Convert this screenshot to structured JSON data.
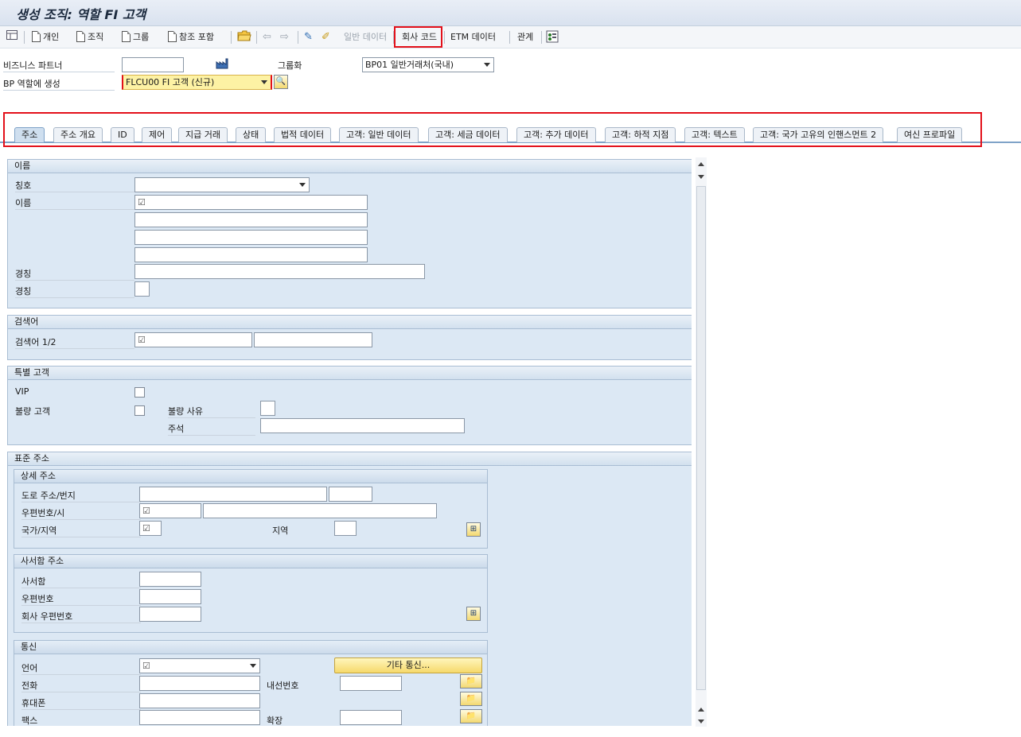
{
  "window": {
    "title": "생성 조직: 역할 FI 고객"
  },
  "toolbar": {
    "person": "개인",
    "org": "조직",
    "group": "그룹",
    "ref": "참조 포함",
    "general_data": "일반 데이터",
    "company_code": "회사 코드",
    "etm_data": "ETM 데이터",
    "relations": "관계"
  },
  "header": {
    "bp_label": "비즈니스 파트너",
    "grouping_label": "그룹화",
    "grouping_value": "BP01 일반거래처(국내)",
    "role_label": "BP 역할에 생성",
    "role_value": "FLCU00 FI 고객 (신규)"
  },
  "tabs": [
    "주소",
    "주소 개요",
    "ID",
    "제어",
    "지급 거래",
    "상태",
    "법적 데이터",
    "고객: 일반 데이터",
    "고객: 세금 데이터",
    "고객: 추가 데이터",
    "고객: 하적 지점",
    "고객: 텍스트",
    "고객: 국가 고유의 인핸스먼트 2",
    "여신 프로파일"
  ],
  "name": {
    "title": "이름",
    "salutation": "칭호",
    "name": "이름",
    "title1": "경칭",
    "title2": "경칭",
    "req": "☑"
  },
  "search": {
    "title": "검색어",
    "label": "검색어 1/2",
    "req": "☑"
  },
  "special": {
    "title": "특별 고객",
    "vip": "VIP",
    "bad": "불량 고객",
    "bad_reason": "불량 사유",
    "comment": "주석"
  },
  "std_address": {
    "title": "표준 주소",
    "detail": {
      "title": "상세 주소",
      "street": "도로 주소/번지",
      "postal_city": "우편번호/시",
      "country": "국가/지역",
      "region": "지역",
      "req": "☑"
    },
    "pobox": {
      "title": "사서함 주소",
      "pobox": "사서함",
      "postal": "우편번호",
      "company_postal": "회사 우편번호"
    },
    "comm": {
      "title": "통신",
      "language": "언어",
      "other_btn": "기타 통신...",
      "phone": "전화",
      "extension": "내선번호",
      "mobile": "휴대폰",
      "fax": "팩스",
      "fax_ext": "확장",
      "req": "☑"
    }
  },
  "icons": {
    "expand": "⊞",
    "comm": "📁"
  }
}
